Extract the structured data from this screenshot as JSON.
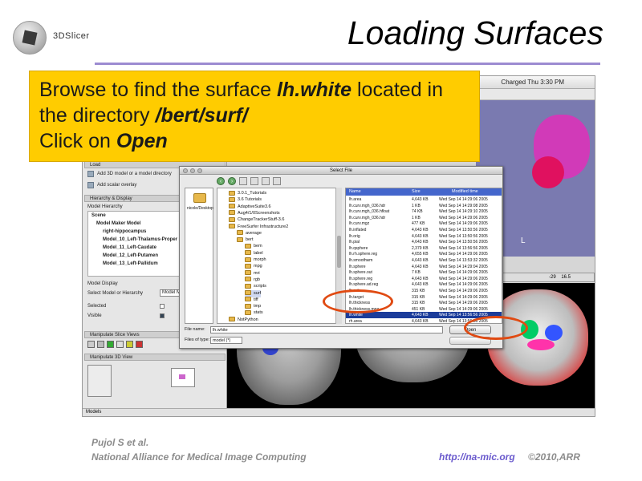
{
  "slide": {
    "title": "Loading Surfaces",
    "logo_text": "3DSlicer"
  },
  "callout": {
    "line1_pre": "Browse to find the surface ",
    "line1_bold": "lh.white",
    "line1_post": " located in",
    "line2_pre": "the directory ",
    "line2_bold": "/bert/surf/",
    "line3_pre": "Click on ",
    "line3_bold": "Open"
  },
  "menubar": {
    "status": "Charged Thu 3:30 PM"
  },
  "left_panel": {
    "load_header": "Load",
    "load_items": [
      "Add 3D model or a model directory",
      "Add scalar overlay"
    ],
    "hierarchy_header": "Hierarchy & Display",
    "model_hierarchy_label": "Model Hierarchy",
    "tree": [
      "Scene",
      "Model Maker Model",
      "right-hippocampus",
      "Model_10_Left-Thalamus-Proper",
      "Model_11_Left-Caudate",
      "Model_12_Left-Putamen",
      "Model_13_Left-Pallidum"
    ],
    "model_display_label": "Model Display",
    "select_model_label": "Select Model or Hierarchy",
    "select_model_value": "Model Mak",
    "selected_label": "Selected",
    "visible_label": "Visible",
    "slice_views_header": "Manipulate Slice Views",
    "view_3d_header": "Manipulate 3D View",
    "status_text": "Models"
  },
  "slice_control": {
    "value": "-29",
    "value2": "16.5"
  },
  "view3d_label": "L",
  "dialog": {
    "title": "Select File",
    "places_label": "nicole/Desktop",
    "directories": [
      {
        "name": "3.0.1_Tutorials",
        "indent": 1
      },
      {
        "name": "3.6 Tutorials",
        "indent": 1
      },
      {
        "name": "AdaptiveSuite3.6",
        "indent": 1
      },
      {
        "name": "Aug4/1/0Screenshots",
        "indent": 1
      },
      {
        "name": "ChangeTrackerStuff-3.6",
        "indent": 1
      },
      {
        "name": "FreeSurfer Infrastructure2",
        "indent": 1
      },
      {
        "name": "average",
        "indent": 2
      },
      {
        "name": "bert",
        "indent": 2
      },
      {
        "name": "bem",
        "indent": 3
      },
      {
        "name": "label",
        "indent": 3
      },
      {
        "name": "morph",
        "indent": 3
      },
      {
        "name": "mpg",
        "indent": 3
      },
      {
        "name": "mri",
        "indent": 3
      },
      {
        "name": "rgb",
        "indent": 3
      },
      {
        "name": "scripts",
        "indent": 3
      },
      {
        "name": "surf",
        "indent": 3
      },
      {
        "name": "tiff",
        "indent": 3
      },
      {
        "name": "tmp",
        "indent": 3
      },
      {
        "name": "stats",
        "indent": 3
      },
      {
        "name": "NotPython",
        "indent": 1
      }
    ],
    "columns": [
      "Name",
      "Size",
      "Modified time"
    ],
    "files": [
      {
        "name": "lh.area",
        "size": "4,643 KB",
        "date": "Wed Sep 14 14:29:06 2005"
      },
      {
        "name": "lh.curv.mgh_036.hdr",
        "size": "1 KB",
        "date": "Wed Sep 14 14:29:08 2005"
      },
      {
        "name": "lh.curv.mgh_036.hfloat",
        "size": "74 KB",
        "date": "Wed Sep 14 14:29:10 2005"
      },
      {
        "name": "lh.curv.mgh_036.hdr",
        "size": "1 KB",
        "date": "Wed Sep 14 14:29:06 2005"
      },
      {
        "name": "lh.curv.mgz",
        "size": "477 KB",
        "date": "Wed Sep 14 14:29:06 2005"
      },
      {
        "name": "lh.inflated",
        "size": "4,643 KB",
        "date": "Wed Sep 14 13:50:56 2005"
      },
      {
        "name": "lh.orig",
        "size": "4,643 KB",
        "date": "Wed Sep 14 13:50:56 2005"
      },
      {
        "name": "lh.pial",
        "size": "4,643 KB",
        "date": "Wed Sep 14 13:50:56 2005"
      },
      {
        "name": "lh.qsphere",
        "size": "2,379 KB",
        "date": "Wed Sep 14 13:56:56 2005"
      },
      {
        "name": "lh.rh.sphere.reg",
        "size": "4,655 KB",
        "date": "Wed Sep 14 14:29:06 2005"
      },
      {
        "name": "lh.smoothwm",
        "size": "4,643 KB",
        "date": "Wed Sep 14 13:53:32 2005"
      },
      {
        "name": "lh.sphere",
        "size": "4,643 KB",
        "date": "Wed Sep 14 14:29:04 2005"
      },
      {
        "name": "lh.sphere.out",
        "size": "7 KB",
        "date": "Wed Sep 14 14:29:06 2005"
      },
      {
        "name": "lh.sphere.reg",
        "size": "4,643 KB",
        "date": "Wed Sep 14 14:29:06 2005"
      },
      {
        "name": "lh.sphere.ad.reg",
        "size": "4,643 KB",
        "date": "Wed Sep 14 14:29:06 2005"
      },
      {
        "name": "lh.sulc",
        "size": "315 KB",
        "date": "Wed Sep 14 14:29:06 2005"
      },
      {
        "name": "lh.target",
        "size": "315 KB",
        "date": "Wed Sep 14 14:29:06 2005"
      },
      {
        "name": "lh.thickness",
        "size": "315 KB",
        "date": "Wed Sep 14 14:29:06 2005"
      },
      {
        "name": "lh.thickness.mgz",
        "size": "451 KB",
        "date": "Wed Sep 14 14:29:06 2005"
      },
      {
        "name": "lh.white",
        "size": "4,643 KB",
        "date": "Wed Sep 14 13:56:56 2005",
        "selected": true
      },
      {
        "name": "rh.area",
        "size": "4,643 KB",
        "date": "Wed Sep 14 13:56:56 2005"
      }
    ],
    "file_name_label": "File name:",
    "file_name_value": "lh.white",
    "files_of_type_label": "Files of type:",
    "files_of_type_value": "model (*)",
    "open_label": "Open"
  },
  "footer": {
    "authors": "Pujol S et al.",
    "org": "National Alliance for Medical Image Computing",
    "url": "http://na-mic.org",
    "copyright": "©2010,ARR"
  },
  "colors": {
    "callout_bg": "#ffcc00",
    "title_rule": "#9c8bd1",
    "ring": "#e04a12",
    "url": "#6a5acd"
  }
}
